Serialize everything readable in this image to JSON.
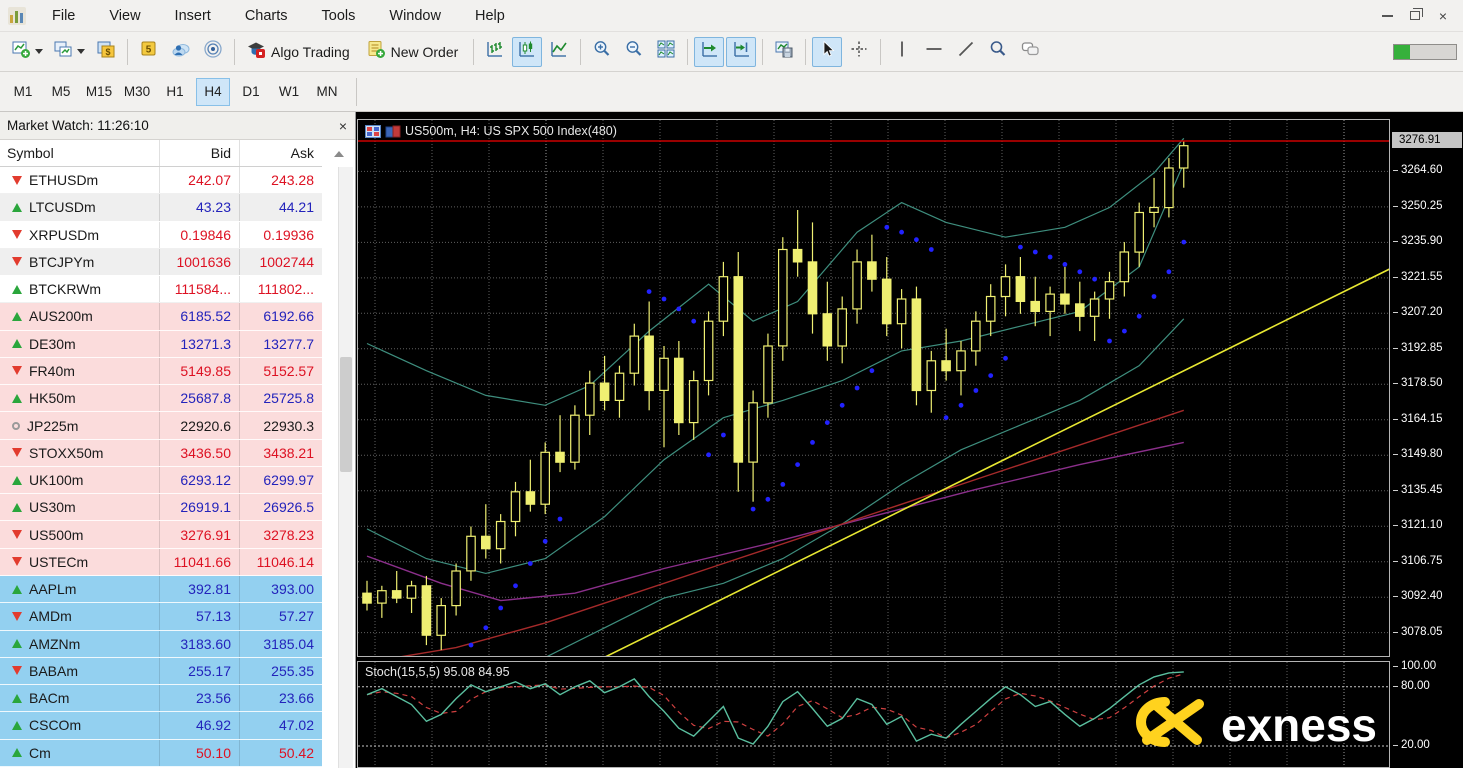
{
  "window": {
    "controls": {
      "minimize": "minimize",
      "restore": "restore",
      "close_glyph": "×"
    }
  },
  "menu": {
    "items": [
      "File",
      "View",
      "Insert",
      "Charts",
      "Tools",
      "Window",
      "Help"
    ]
  },
  "toolbar": {
    "algo_trading_label": "Algo Trading",
    "new_order_label": "New Order",
    "groups": [
      [
        {
          "icon": "new-chart-icon",
          "caret": true
        },
        {
          "icon": "profiles-icon",
          "caret": true
        },
        {
          "icon": "market-watch-icon"
        }
      ],
      [
        {
          "icon": "mql5-icon"
        },
        {
          "icon": "community-icon"
        },
        {
          "icon": "signals-icon"
        }
      ],
      [
        {
          "icon": "algo-trading-icon",
          "label": "Algo Trading"
        },
        {
          "icon": "new-order-icon",
          "label": "New Order"
        }
      ],
      [
        {
          "icon": "bar-chart-icon"
        },
        {
          "icon": "candlestick-chart-icon",
          "active": true
        },
        {
          "icon": "line-chart-icon"
        }
      ],
      [
        {
          "icon": "zoom-in-icon"
        },
        {
          "icon": "zoom-out-icon"
        },
        {
          "icon": "tile-windows-icon"
        }
      ],
      [
        {
          "icon": "auto-scroll-icon",
          "active": true
        },
        {
          "icon": "chart-shift-icon",
          "active": true
        }
      ],
      [
        {
          "icon": "save-template-icon"
        }
      ],
      [
        {
          "icon": "cursor-icon",
          "active": true
        },
        {
          "icon": "crosshair-icon"
        }
      ],
      [
        {
          "icon": "vertical-line-icon"
        },
        {
          "icon": "horizontal-line-icon"
        },
        {
          "icon": "trendline-icon"
        },
        {
          "icon": "magnifier-icon"
        },
        {
          "icon": "comments-icon"
        }
      ]
    ],
    "status_progress_percent": 25
  },
  "timeframes": {
    "items": [
      "M1",
      "M5",
      "M15",
      "M30",
      "H1",
      "H4",
      "D1",
      "W1",
      "MN"
    ],
    "active": "H4"
  },
  "market_watch": {
    "title": "Market Watch: 11:26:10",
    "columns": [
      "Symbol",
      "Bid",
      "Ask"
    ],
    "rows": [
      {
        "symbol": "ETHUSDm",
        "bid": "242.07",
        "ask": "243.28",
        "arrow": "down",
        "group": "plain",
        "alt": false,
        "price_color": "red"
      },
      {
        "symbol": "LTCUSDm",
        "bid": "43.23",
        "ask": "44.21",
        "arrow": "up",
        "group": "plain",
        "alt": true,
        "price_color": "blue"
      },
      {
        "symbol": "XRPUSDm",
        "bid": "0.19846",
        "ask": "0.19936",
        "arrow": "down",
        "group": "plain",
        "alt": false,
        "price_color": "red"
      },
      {
        "symbol": "BTCJPYm",
        "bid": "1001636",
        "ask": "1002744",
        "arrow": "down",
        "group": "plain",
        "alt": true,
        "price_color": "red"
      },
      {
        "symbol": "BTCKRWm",
        "bid": "111584...",
        "ask": "111802...",
        "arrow": "up",
        "group": "plain",
        "alt": false,
        "price_color": "red"
      },
      {
        "symbol": "AUS200m",
        "bid": "6185.52",
        "ask": "6192.66",
        "arrow": "up",
        "group": "pink",
        "alt": false,
        "price_color": "blue"
      },
      {
        "symbol": "DE30m",
        "bid": "13271.3",
        "ask": "13277.7",
        "arrow": "up",
        "group": "pink",
        "alt": false,
        "price_color": "blue"
      },
      {
        "symbol": "FR40m",
        "bid": "5149.85",
        "ask": "5152.57",
        "arrow": "down",
        "group": "pink",
        "alt": false,
        "price_color": "red"
      },
      {
        "symbol": "HK50m",
        "bid": "25687.8",
        "ask": "25725.8",
        "arrow": "up",
        "group": "pink",
        "alt": false,
        "price_color": "blue"
      },
      {
        "symbol": "JP225m",
        "bid": "22920.6",
        "ask": "22930.3",
        "arrow": "neutral",
        "group": "pink",
        "alt": false,
        "price_color": "black"
      },
      {
        "symbol": "STOXX50m",
        "bid": "3436.50",
        "ask": "3438.21",
        "arrow": "down",
        "group": "pink",
        "alt": false,
        "price_color": "red"
      },
      {
        "symbol": "UK100m",
        "bid": "6293.12",
        "ask": "6299.97",
        "arrow": "up",
        "group": "pink",
        "alt": false,
        "price_color": "blue"
      },
      {
        "symbol": "US30m",
        "bid": "26919.1",
        "ask": "26926.5",
        "arrow": "up",
        "group": "pink",
        "alt": false,
        "price_color": "blue"
      },
      {
        "symbol": "US500m",
        "bid": "3276.91",
        "ask": "3278.23",
        "arrow": "down",
        "group": "pink",
        "alt": false,
        "price_color": "red"
      },
      {
        "symbol": "USTECm",
        "bid": "11041.66",
        "ask": "11046.14",
        "arrow": "down",
        "group": "pink",
        "alt": false,
        "price_color": "red"
      },
      {
        "symbol": "AAPLm",
        "bid": "392.81",
        "ask": "393.00",
        "arrow": "up",
        "group": "blue",
        "alt": false,
        "price_color": "blue"
      },
      {
        "symbol": "AMDm",
        "bid": "57.13",
        "ask": "57.27",
        "arrow": "down",
        "group": "blue",
        "alt": false,
        "price_color": "blue"
      },
      {
        "symbol": "AMZNm",
        "bid": "3183.60",
        "ask": "3185.04",
        "arrow": "up",
        "group": "blue",
        "alt": false,
        "price_color": "blue"
      },
      {
        "symbol": "BABAm",
        "bid": "255.17",
        "ask": "255.35",
        "arrow": "down",
        "group": "blue",
        "alt": false,
        "price_color": "blue"
      },
      {
        "symbol": "BACm",
        "bid": "23.56",
        "ask": "23.66",
        "arrow": "up",
        "group": "blue",
        "alt": false,
        "price_color": "blue"
      },
      {
        "symbol": "CSCOm",
        "bid": "46.92",
        "ask": "47.02",
        "arrow": "up",
        "group": "blue",
        "alt": false,
        "price_color": "blue"
      },
      {
        "symbol": "Cm",
        "bid": "50.10",
        "ask": "50.42",
        "arrow": "up",
        "group": "blue",
        "alt": false,
        "price_color": "red"
      }
    ]
  },
  "chart": {
    "title": "US500m, H4:  US SPX 500 Index(480)",
    "price_axis": {
      "current": "3276.91",
      "labels": [
        3264.6,
        3250.25,
        3235.9,
        3221.55,
        3207.2,
        3192.85,
        3178.5,
        3164.15,
        3149.8,
        3135.45,
        3121.1,
        3106.75,
        3092.4,
        3078.05
      ]
    },
    "stoch_labels": [
      100.0,
      80.0,
      20.0
    ]
  },
  "watermark": {
    "text": "exness",
    "logo_color": "#ffd21e"
  },
  "colors": {
    "candle": "#efef72",
    "sar": "#2222ff",
    "bands": "#3e8e7e",
    "ma_purple": "#8b2f8b",
    "ma_red": "#a52a2a",
    "trendline": "#e8e832",
    "price_line": "#cc0000",
    "stoch_k": "#5abf9f",
    "stoch_d": "#d04040",
    "grid": "#606060",
    "grid_bright": "#9a9a9a",
    "level": "#c8c8c8"
  },
  "chart_data": [
    {
      "type": "candlestick",
      "symbol": "US500m",
      "timeframe": "H4",
      "title": "US500m, H4:  US SPX 500 Index(480)",
      "bars_in_title": 480,
      "current_price": 3276.91,
      "ylim": [
        3068.6,
        3285.4
      ],
      "candles_ohlc": [
        [
          3094,
          3099,
          3087,
          3090
        ],
        [
          3090,
          3097,
          3084,
          3095
        ],
        [
          3095,
          3103,
          3090,
          3092
        ],
        [
          3092,
          3099,
          3086,
          3097
        ],
        [
          3097,
          3101,
          3073,
          3077
        ],
        [
          3077,
          3092,
          3071,
          3089
        ],
        [
          3089,
          3106,
          3085,
          3103
        ],
        [
          3103,
          3121,
          3099,
          3117
        ],
        [
          3117,
          3130,
          3108,
          3112
        ],
        [
          3112,
          3126,
          3106,
          3123
        ],
        [
          3123,
          3139,
          3117,
          3135
        ],
        [
          3135,
          3148,
          3127,
          3130
        ],
        [
          3130,
          3155,
          3126,
          3151
        ],
        [
          3151,
          3166,
          3143,
          3147
        ],
        [
          3147,
          3170,
          3144,
          3166
        ],
        [
          3166,
          3184,
          3158,
          3179
        ],
        [
          3179,
          3190,
          3168,
          3172
        ],
        [
          3172,
          3186,
          3165,
          3183
        ],
        [
          3183,
          3203,
          3178,
          3198
        ],
        [
          3198,
          3212,
          3168,
          3176
        ],
        [
          3176,
          3194,
          3153,
          3189
        ],
        [
          3189,
          3196,
          3158,
          3163
        ],
        [
          3163,
          3184,
          3156,
          3180
        ],
        [
          3180,
          3208,
          3174,
          3204
        ],
        [
          3204,
          3228,
          3198,
          3222
        ],
        [
          3222,
          3232,
          3135,
          3147
        ],
        [
          3147,
          3176,
          3131,
          3171
        ],
        [
          3171,
          3199,
          3165,
          3194
        ],
        [
          3194,
          3238,
          3188,
          3233
        ],
        [
          3233,
          3249,
          3222,
          3228
        ],
        [
          3228,
          3244,
          3199,
          3207
        ],
        [
          3207,
          3220,
          3188,
          3194
        ],
        [
          3194,
          3214,
          3187,
          3209
        ],
        [
          3209,
          3233,
          3203,
          3228
        ],
        [
          3228,
          3239,
          3216,
          3221
        ],
        [
          3221,
          3230,
          3198,
          3203
        ],
        [
          3203,
          3217,
          3193,
          3213
        ],
        [
          3213,
          3218,
          3170,
          3176
        ],
        [
          3176,
          3192,
          3167,
          3188
        ],
        [
          3188,
          3201,
          3180,
          3184
        ],
        [
          3184,
          3196,
          3174,
          3192
        ],
        [
          3192,
          3208,
          3186,
          3204
        ],
        [
          3204,
          3219,
          3198,
          3214
        ],
        [
          3214,
          3227,
          3206,
          3222
        ],
        [
          3222,
          3230,
          3207,
          3212
        ],
        [
          3212,
          3222,
          3202,
          3208
        ],
        [
          3208,
          3218,
          3198,
          3215
        ],
        [
          3215,
          3226,
          3207,
          3211
        ],
        [
          3211,
          3220,
          3200,
          3206
        ],
        [
          3206,
          3216,
          3196,
          3213
        ],
        [
          3213,
          3224,
          3205,
          3220
        ],
        [
          3220,
          3236,
          3214,
          3232
        ],
        [
          3232,
          3252,
          3226,
          3248
        ],
        [
          3248,
          3262,
          3242,
          3250
        ],
        [
          3250,
          3270,
          3246,
          3266
        ],
        [
          3266,
          3277,
          3258,
          3275
        ]
      ],
      "sar_dots": [
        [
          5,
          3062
        ],
        [
          6,
          3067
        ],
        [
          7,
          3073
        ],
        [
          8,
          3080
        ],
        [
          9,
          3088
        ],
        [
          10,
          3097
        ],
        [
          11,
          3106
        ],
        [
          12,
          3115
        ],
        [
          13,
          3124
        ],
        [
          19,
          3216
        ],
        [
          20,
          3213
        ],
        [
          21,
          3209
        ],
        [
          22,
          3204
        ],
        [
          23,
          3150
        ],
        [
          24,
          3158
        ],
        [
          26,
          3128
        ],
        [
          27,
          3132
        ],
        [
          28,
          3138
        ],
        [
          29,
          3146
        ],
        [
          30,
          3155
        ],
        [
          31,
          3163
        ],
        [
          32,
          3170
        ],
        [
          33,
          3177
        ],
        [
          34,
          3184
        ],
        [
          35,
          3242
        ],
        [
          36,
          3240
        ],
        [
          37,
          3237
        ],
        [
          38,
          3233
        ],
        [
          39,
          3165
        ],
        [
          40,
          3170
        ],
        [
          41,
          3176
        ],
        [
          42,
          3182
        ],
        [
          43,
          3189
        ],
        [
          44,
          3234
        ],
        [
          45,
          3232
        ],
        [
          46,
          3230
        ],
        [
          47,
          3227
        ],
        [
          48,
          3224
        ],
        [
          49,
          3221
        ],
        [
          50,
          3196
        ],
        [
          51,
          3200
        ],
        [
          52,
          3206
        ],
        [
          53,
          3214
        ],
        [
          54,
          3224
        ],
        [
          55,
          3236
        ]
      ],
      "bollinger_upper": [
        [
          0,
          3195
        ],
        [
          4,
          3184
        ],
        [
          8,
          3174
        ],
        [
          12,
          3170
        ],
        [
          15,
          3178
        ],
        [
          19,
          3200
        ],
        [
          23,
          3219
        ],
        [
          26,
          3204
        ],
        [
          29,
          3212
        ],
        [
          33,
          3240
        ],
        [
          36,
          3252
        ],
        [
          39,
          3244
        ],
        [
          43,
          3238
        ],
        [
          47,
          3242
        ],
        [
          50,
          3250
        ],
        [
          53,
          3264
        ],
        [
          55,
          3278
        ]
      ],
      "bollinger_middle": [
        [
          0,
          3120
        ],
        [
          4,
          3108
        ],
        [
          8,
          3102
        ],
        [
          12,
          3108
        ],
        [
          16,
          3125
        ],
        [
          20,
          3148
        ],
        [
          24,
          3165
        ],
        [
          28,
          3172
        ],
        [
          32,
          3180
        ],
        [
          36,
          3192
        ],
        [
          40,
          3196
        ],
        [
          44,
          3202
        ],
        [
          48,
          3208
        ],
        [
          52,
          3226
        ],
        [
          55,
          3268
        ]
      ],
      "bollinger_lower": [
        [
          0,
          3062
        ],
        [
          4,
          3056
        ],
        [
          8,
          3060
        ],
        [
          12,
          3068
        ],
        [
          16,
          3080
        ],
        [
          20,
          3092
        ],
        [
          24,
          3098
        ],
        [
          28,
          3108
        ],
        [
          32,
          3122
        ],
        [
          36,
          3138
        ],
        [
          40,
          3152
        ],
        [
          44,
          3162
        ],
        [
          48,
          3172
        ],
        [
          52,
          3186
        ],
        [
          55,
          3205
        ]
      ],
      "ma_purple": [
        [
          0,
          3109
        ],
        [
          5,
          3098
        ],
        [
          9,
          3091
        ],
        [
          14,
          3094
        ],
        [
          20,
          3104
        ],
        [
          27,
          3114
        ],
        [
          34,
          3125
        ],
        [
          41,
          3136
        ],
        [
          48,
          3146
        ],
        [
          55,
          3155
        ]
      ],
      "ma_red": [
        [
          0,
          3066
        ],
        [
          6,
          3072
        ],
        [
          12,
          3082
        ],
        [
          18,
          3094
        ],
        [
          24,
          3106
        ],
        [
          30,
          3118
        ],
        [
          36,
          3130
        ],
        [
          42,
          3142
        ],
        [
          48,
          3154
        ],
        [
          55,
          3168
        ]
      ],
      "trendline": [
        [
          15.3,
          3066
        ],
        [
          70.5,
          3230
        ]
      ]
    },
    {
      "type": "line",
      "label": "Stoch(15,5,5) 95.08 84.95",
      "indicator": "Stochastic",
      "params": [
        15,
        5,
        5
      ],
      "k_percent": 95.08,
      "d_percent": 84.95,
      "levels": [
        80,
        20
      ],
      "ylim": [
        0,
        105
      ],
      "k_values": [
        72,
        78,
        70,
        62,
        45,
        52,
        68,
        82,
        75,
        80,
        85,
        78,
        83,
        72,
        80,
        86,
        74,
        80,
        88,
        70,
        55,
        38,
        30,
        45,
        60,
        28,
        22,
        40,
        65,
        75,
        58,
        40,
        48,
        68,
        62,
        42,
        50,
        25,
        32,
        28,
        42,
        55,
        68,
        80,
        72,
        60,
        65,
        52,
        40,
        48,
        58,
        70,
        82,
        90,
        94,
        95.08
      ]
    }
  ]
}
